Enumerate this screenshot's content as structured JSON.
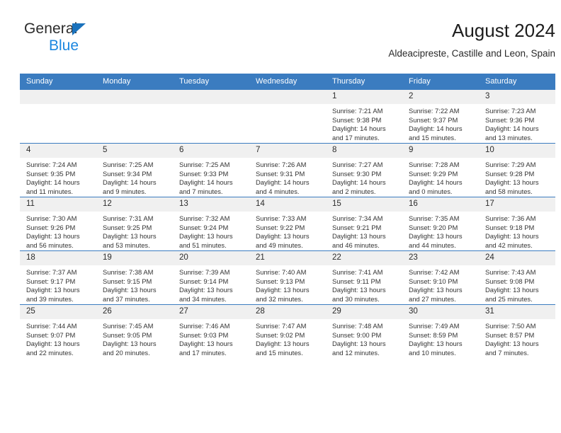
{
  "brand": {
    "name_top": "General",
    "name_bottom": "Blue",
    "triangle_color": "#1b72bc",
    "blue_color": "#1b87e0"
  },
  "header": {
    "title": "August 2024",
    "subtitle": "Aldeacipreste, Castille and Leon, Spain"
  },
  "theme": {
    "header_blue": "#3b7cc0",
    "daynum_gray": "#f0f0f0"
  },
  "weekdays": [
    "Sunday",
    "Monday",
    "Tuesday",
    "Wednesday",
    "Thursday",
    "Friday",
    "Saturday"
  ],
  "weeks": [
    [
      {
        "day": "",
        "sunrise": "",
        "sunset": "",
        "daylight": ""
      },
      {
        "day": "",
        "sunrise": "",
        "sunset": "",
        "daylight": ""
      },
      {
        "day": "",
        "sunrise": "",
        "sunset": "",
        "daylight": ""
      },
      {
        "day": "",
        "sunrise": "",
        "sunset": "",
        "daylight": ""
      },
      {
        "day": "1",
        "sunrise": "Sunrise: 7:21 AM",
        "sunset": "Sunset: 9:38 PM",
        "daylight": "Daylight: 14 hours and 17 minutes."
      },
      {
        "day": "2",
        "sunrise": "Sunrise: 7:22 AM",
        "sunset": "Sunset: 9:37 PM",
        "daylight": "Daylight: 14 hours and 15 minutes."
      },
      {
        "day": "3",
        "sunrise": "Sunrise: 7:23 AM",
        "sunset": "Sunset: 9:36 PM",
        "daylight": "Daylight: 14 hours and 13 minutes."
      }
    ],
    [
      {
        "day": "4",
        "sunrise": "Sunrise: 7:24 AM",
        "sunset": "Sunset: 9:35 PM",
        "daylight": "Daylight: 14 hours and 11 minutes."
      },
      {
        "day": "5",
        "sunrise": "Sunrise: 7:25 AM",
        "sunset": "Sunset: 9:34 PM",
        "daylight": "Daylight: 14 hours and 9 minutes."
      },
      {
        "day": "6",
        "sunrise": "Sunrise: 7:25 AM",
        "sunset": "Sunset: 9:33 PM",
        "daylight": "Daylight: 14 hours and 7 minutes."
      },
      {
        "day": "7",
        "sunrise": "Sunrise: 7:26 AM",
        "sunset": "Sunset: 9:31 PM",
        "daylight": "Daylight: 14 hours and 4 minutes."
      },
      {
        "day": "8",
        "sunrise": "Sunrise: 7:27 AM",
        "sunset": "Sunset: 9:30 PM",
        "daylight": "Daylight: 14 hours and 2 minutes."
      },
      {
        "day": "9",
        "sunrise": "Sunrise: 7:28 AM",
        "sunset": "Sunset: 9:29 PM",
        "daylight": "Daylight: 14 hours and 0 minutes."
      },
      {
        "day": "10",
        "sunrise": "Sunrise: 7:29 AM",
        "sunset": "Sunset: 9:28 PM",
        "daylight": "Daylight: 13 hours and 58 minutes."
      }
    ],
    [
      {
        "day": "11",
        "sunrise": "Sunrise: 7:30 AM",
        "sunset": "Sunset: 9:26 PM",
        "daylight": "Daylight: 13 hours and 56 minutes."
      },
      {
        "day": "12",
        "sunrise": "Sunrise: 7:31 AM",
        "sunset": "Sunset: 9:25 PM",
        "daylight": "Daylight: 13 hours and 53 minutes."
      },
      {
        "day": "13",
        "sunrise": "Sunrise: 7:32 AM",
        "sunset": "Sunset: 9:24 PM",
        "daylight": "Daylight: 13 hours and 51 minutes."
      },
      {
        "day": "14",
        "sunrise": "Sunrise: 7:33 AM",
        "sunset": "Sunset: 9:22 PM",
        "daylight": "Daylight: 13 hours and 49 minutes."
      },
      {
        "day": "15",
        "sunrise": "Sunrise: 7:34 AM",
        "sunset": "Sunset: 9:21 PM",
        "daylight": "Daylight: 13 hours and 46 minutes."
      },
      {
        "day": "16",
        "sunrise": "Sunrise: 7:35 AM",
        "sunset": "Sunset: 9:20 PM",
        "daylight": "Daylight: 13 hours and 44 minutes."
      },
      {
        "day": "17",
        "sunrise": "Sunrise: 7:36 AM",
        "sunset": "Sunset: 9:18 PM",
        "daylight": "Daylight: 13 hours and 42 minutes."
      }
    ],
    [
      {
        "day": "18",
        "sunrise": "Sunrise: 7:37 AM",
        "sunset": "Sunset: 9:17 PM",
        "daylight": "Daylight: 13 hours and 39 minutes."
      },
      {
        "day": "19",
        "sunrise": "Sunrise: 7:38 AM",
        "sunset": "Sunset: 9:15 PM",
        "daylight": "Daylight: 13 hours and 37 minutes."
      },
      {
        "day": "20",
        "sunrise": "Sunrise: 7:39 AM",
        "sunset": "Sunset: 9:14 PM",
        "daylight": "Daylight: 13 hours and 34 minutes."
      },
      {
        "day": "21",
        "sunrise": "Sunrise: 7:40 AM",
        "sunset": "Sunset: 9:13 PM",
        "daylight": "Daylight: 13 hours and 32 minutes."
      },
      {
        "day": "22",
        "sunrise": "Sunrise: 7:41 AM",
        "sunset": "Sunset: 9:11 PM",
        "daylight": "Daylight: 13 hours and 30 minutes."
      },
      {
        "day": "23",
        "sunrise": "Sunrise: 7:42 AM",
        "sunset": "Sunset: 9:10 PM",
        "daylight": "Daylight: 13 hours and 27 minutes."
      },
      {
        "day": "24",
        "sunrise": "Sunrise: 7:43 AM",
        "sunset": "Sunset: 9:08 PM",
        "daylight": "Daylight: 13 hours and 25 minutes."
      }
    ],
    [
      {
        "day": "25",
        "sunrise": "Sunrise: 7:44 AM",
        "sunset": "Sunset: 9:07 PM",
        "daylight": "Daylight: 13 hours and 22 minutes."
      },
      {
        "day": "26",
        "sunrise": "Sunrise: 7:45 AM",
        "sunset": "Sunset: 9:05 PM",
        "daylight": "Daylight: 13 hours and 20 minutes."
      },
      {
        "day": "27",
        "sunrise": "Sunrise: 7:46 AM",
        "sunset": "Sunset: 9:03 PM",
        "daylight": "Daylight: 13 hours and 17 minutes."
      },
      {
        "day": "28",
        "sunrise": "Sunrise: 7:47 AM",
        "sunset": "Sunset: 9:02 PM",
        "daylight": "Daylight: 13 hours and 15 minutes."
      },
      {
        "day": "29",
        "sunrise": "Sunrise: 7:48 AM",
        "sunset": "Sunset: 9:00 PM",
        "daylight": "Daylight: 13 hours and 12 minutes."
      },
      {
        "day": "30",
        "sunrise": "Sunrise: 7:49 AM",
        "sunset": "Sunset: 8:59 PM",
        "daylight": "Daylight: 13 hours and 10 minutes."
      },
      {
        "day": "31",
        "sunrise": "Sunrise: 7:50 AM",
        "sunset": "Sunset: 8:57 PM",
        "daylight": "Daylight: 13 hours and 7 minutes."
      }
    ]
  ]
}
